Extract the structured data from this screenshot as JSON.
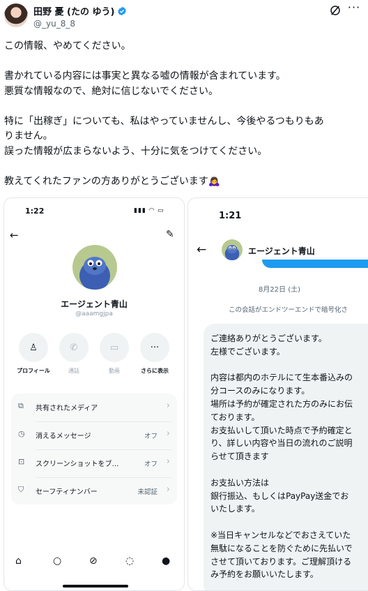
{
  "author": {
    "display_name": "田野 憂 (たの ゆう)",
    "handle": "@_yu_8_8"
  },
  "post": {
    "lines": [
      "この情報、やめてください。",
      "",
      "書かれている内容には事実と異なる嘘の情報が含まれています。",
      "悪質な情報なので、絶対に信じないでください。",
      "",
      "特に「出稼ぎ」についても、私はやっていませんし、今後やるつもりもあ",
      "りません。",
      "誤った情報が広まらないよう、十分に気をつけてください。",
      "",
      "教えてくれたファンの方ありがとうございます🙇‍♀️"
    ]
  },
  "left_screenshot": {
    "time": "1:22",
    "profile_name": "エージェント青山",
    "profile_handle": "@aaamgjpa",
    "actions": [
      {
        "label": "プロフィール",
        "icon": "person-icon"
      },
      {
        "label": "通話",
        "icon": "phone-icon"
      },
      {
        "label": "動画",
        "icon": "video-icon"
      },
      {
        "label": "さらに表示",
        "icon": "more-icon"
      }
    ],
    "settings": [
      {
        "label": "共有されたメディア",
        "value": "",
        "icon": "media-icon"
      },
      {
        "label": "消えるメッセージ",
        "value": "オフ",
        "icon": "timer-icon"
      },
      {
        "label": "スクリーンショットをブ…",
        "value": "オフ",
        "icon": "screenshot-icon"
      },
      {
        "label": "セーフティナンバー",
        "value": "未認証",
        "icon": "shield-icon"
      }
    ]
  },
  "right_screenshot": {
    "time": "1:21",
    "chat_title": "エージェント青山",
    "date": "8月22日 (土)",
    "e2e_notice": "この会話がエンドツーエンドで暗号化さ",
    "message_lines": [
      "ご連絡ありがとうございます。",
      "左様でございます。",
      "",
      "内容は都内のホテルにて生本番込みの",
      "分コースのみになります。",
      "場所は予約が確定された方のみにお伝",
      "ております。",
      "お支払いして頂いた時点で予約確定と",
      "り、詳しい内容や当日の流れのご説明",
      "らせて頂きます",
      "",
      "お支払い方法は",
      "銀行振込、もしくはPayPay送金でお",
      "いたします。",
      "",
      "※当日キャンセルなどでおさえていた",
      "無駄になることを防ぐために先払いで",
      "させて頂いております。ご理解頂ける",
      "み予約をお願いいたします。"
    ]
  },
  "colors": {
    "verified": "#1d9bf0",
    "text": "#0f1419",
    "muted": "#536471"
  }
}
